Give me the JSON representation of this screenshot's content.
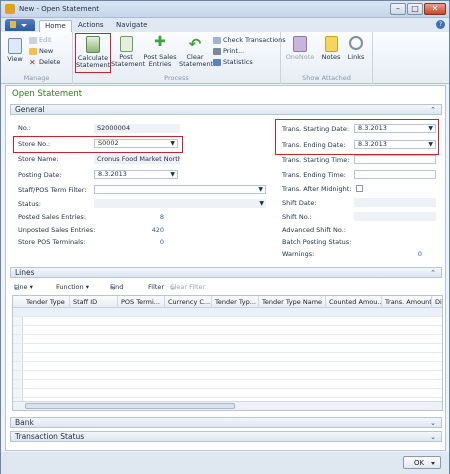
{
  "window": {
    "title": "New - Open Statement"
  },
  "tabs": [
    {
      "label": "Home"
    },
    {
      "label": "Actions"
    },
    {
      "label": "Navigate"
    }
  ],
  "ribbon": {
    "manage": {
      "label": "Manage",
      "view": "View",
      "edit": "Edit",
      "new": "New",
      "delete": "Delete"
    },
    "process": {
      "label": "Process",
      "calculate": [
        "Calculate",
        "Statement"
      ],
      "post": [
        "Post",
        "Statement"
      ],
      "post_sales": [
        "Post Sales",
        "Entries"
      ],
      "clear": [
        "Clear",
        "Statement"
      ],
      "check": "Check Transactions",
      "print": "Print...",
      "stats": "Statistics"
    },
    "show_attached": {
      "label": "Show Attached",
      "onenote": "OneNote",
      "notes": "Notes",
      "links": "Links"
    }
  },
  "page": {
    "title": "Open Statement"
  },
  "general": {
    "header": "General",
    "no_label": "No.:",
    "no_value": "S2000004",
    "store_no_label": "Store No.:",
    "store_no_value": "S0002",
    "store_name_label": "Store Name:",
    "store_name_value": "Cronus Food Market North",
    "posting_date_label": "Posting Date:",
    "posting_date_value": "8.3.2013",
    "staff_filter_label": "Staff/POS Term Filter:",
    "status_label": "Status:",
    "posted_sales_label": "Posted Sales Entries:",
    "posted_sales_value": "8",
    "unposted_sales_label": "Unposted Sales Entries:",
    "unposted_sales_value": "420",
    "store_pos_label": "Store POS Terminals:",
    "store_pos_value": "0",
    "trans_start_date_label": "Trans. Starting Date:",
    "trans_start_date_value": "8.3.2013",
    "trans_end_date_label": "Trans. Ending Date:",
    "trans_end_date_value": "8.3.2013",
    "trans_start_time_label": "Trans. Starting Time:",
    "trans_end_time_label": "Trans. Ending Time:",
    "trans_after_midnight_label": "Trans. After Midnight:",
    "shift_date_label": "Shift Date:",
    "shift_no_label": "Shift No.:",
    "adv_shift_label": "Advanced Shift No.:",
    "batch_label": "Batch Posting Status:",
    "warnings_label": "Warnings:",
    "warnings_value": "0"
  },
  "lines": {
    "header": "Lines",
    "toolbar": {
      "line": "Line",
      "function": "Function",
      "find": "Find",
      "filter": "Filter",
      "clear_filter": "Clear Filter"
    },
    "columns": [
      "Tender Type",
      "Staff ID",
      "POS Termi...",
      "Currency C...",
      "Tender Typ...",
      "Tender Type Name",
      "Counted Amou...",
      "Trans. Amount",
      "Di"
    ]
  },
  "bank": {
    "header": "Bank"
  },
  "transaction_status": {
    "header": "Transaction Status"
  },
  "footer": {
    "ok": "OK"
  }
}
